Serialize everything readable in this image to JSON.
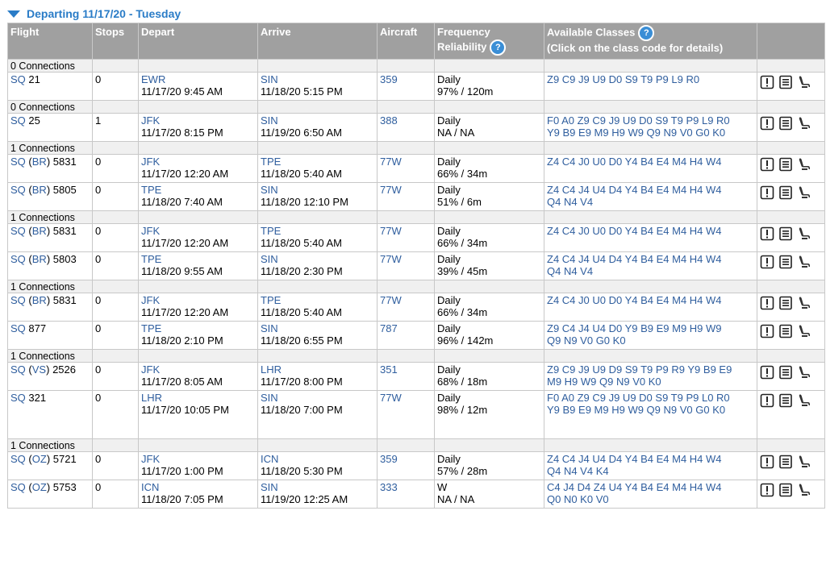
{
  "title": "Departing 11/17/20 - Tuesday",
  "headers": {
    "flight": "Flight",
    "stops": "Stops",
    "depart": "Depart",
    "arrive": "Arrive",
    "aircraft": "Aircraft",
    "frequency": "Frequency",
    "reliability": "Reliability",
    "classes": "Available Classes",
    "classes_note": "(Click on the class code for details)"
  },
  "groups": [
    {
      "label": "0 Connections",
      "flights": [
        {
          "airline": "SQ",
          "partner": "",
          "number": "21",
          "stops": "0",
          "depart_code": "EWR",
          "depart_time": "11/17/20 9:45 AM",
          "arrive_code": "SIN",
          "arrive_time": "11/18/20 5:15 PM",
          "aircraft": "359",
          "frequency": "Daily",
          "reliability": "97% / 120m",
          "classes": [
            "Z9 C9 J9 U9 D0 S9 T9 P9 L9 R0"
          ]
        }
      ]
    },
    {
      "label": "0 Connections",
      "flights": [
        {
          "airline": "SQ",
          "partner": "",
          "number": "25",
          "stops": "1",
          "depart_code": "JFK",
          "depart_time": "11/17/20 8:15 PM",
          "arrive_code": "SIN",
          "arrive_time": "11/19/20 6:50 AM",
          "aircraft": "388",
          "frequency": "Daily",
          "reliability": "NA / NA",
          "classes": [
            "F0 A0 Z9 C9 J9 U9 D0 S9 T9 P9 L9 R0",
            "Y9 B9 E9 M9 H9 W9 Q9 N9 V0 G0 K0"
          ]
        }
      ]
    },
    {
      "label": "1 Connections",
      "flights": [
        {
          "airline": "SQ",
          "partner": "BR",
          "number": "5831",
          "stops": "0",
          "depart_code": "JFK",
          "depart_time": "11/17/20 12:20 AM",
          "arrive_code": "TPE",
          "arrive_time": "11/18/20 5:40 AM",
          "aircraft": "77W",
          "frequency": "Daily",
          "reliability": "66% / 34m",
          "classes": [
            "Z4 C4 J0 U0 D0 Y4 B4 E4 M4 H4 W4"
          ]
        },
        {
          "airline": "SQ",
          "partner": "BR",
          "number": "5805",
          "stops": "0",
          "depart_code": "TPE",
          "depart_time": "11/18/20 7:40 AM",
          "arrive_code": "SIN",
          "arrive_time": "11/18/20 12:10 PM",
          "aircraft": "77W",
          "frequency": "Daily",
          "reliability": "51% / 6m",
          "classes": [
            "Z4 C4 J4 U4 D4 Y4 B4 E4 M4 H4 W4",
            "Q4 N4 V4"
          ]
        }
      ]
    },
    {
      "label": "1 Connections",
      "flights": [
        {
          "airline": "SQ",
          "partner": "BR",
          "number": "5831",
          "stops": "0",
          "depart_code": "JFK",
          "depart_time": "11/17/20 12:20 AM",
          "arrive_code": "TPE",
          "arrive_time": "11/18/20 5:40 AM",
          "aircraft": "77W",
          "frequency": "Daily",
          "reliability": "66% / 34m",
          "classes": [
            "Z4 C4 J0 U0 D0 Y4 B4 E4 M4 H4 W4"
          ]
        },
        {
          "airline": "SQ",
          "partner": "BR",
          "number": "5803",
          "stops": "0",
          "depart_code": "TPE",
          "depart_time": "11/18/20 9:55 AM",
          "arrive_code": "SIN",
          "arrive_time": "11/18/20 2:30 PM",
          "aircraft": "77W",
          "frequency": "Daily",
          "reliability": "39% / 45m",
          "classes": [
            "Z4 C4 J4 U4 D4 Y4 B4 E4 M4 H4 W4",
            "Q4 N4 V4"
          ]
        }
      ]
    },
    {
      "label": "1 Connections",
      "flights": [
        {
          "airline": "SQ",
          "partner": "BR",
          "number": "5831",
          "stops": "0",
          "depart_code": "JFK",
          "depart_time": "11/17/20 12:20 AM",
          "arrive_code": "TPE",
          "arrive_time": "11/18/20 5:40 AM",
          "aircraft": "77W",
          "frequency": "Daily",
          "reliability": "66% / 34m",
          "classes": [
            "Z4 C4 J0 U0 D0 Y4 B4 E4 M4 H4 W4"
          ]
        },
        {
          "airline": "SQ",
          "partner": "",
          "number": "877",
          "stops": "0",
          "depart_code": "TPE",
          "depart_time": "11/18/20 2:10 PM",
          "arrive_code": "SIN",
          "arrive_time": "11/18/20 6:55 PM",
          "aircraft": "787",
          "frequency": "Daily",
          "reliability": "96% / 142m",
          "classes": [
            "Z9 C4 J4 U4 D0 Y9 B9 E9 M9 H9 W9",
            "Q9 N9 V0 G0 K0"
          ]
        }
      ]
    },
    {
      "label": "1 Connections",
      "flights": [
        {
          "airline": "SQ",
          "partner": "VS",
          "number": "2526",
          "stops": "0",
          "depart_code": "JFK",
          "depart_time": "11/17/20 8:05 AM",
          "arrive_code": "LHR",
          "arrive_time": "11/17/20 8:00 PM",
          "aircraft": "351",
          "frequency": "Daily",
          "reliability": "68% / 18m",
          "classes": [
            "Z9 C9 J9 U9 D9 S9 T9 P9 R9 Y9 B9 E9",
            "M9 H9 W9 Q9 N9 V0 K0"
          ]
        },
        {
          "airline": "SQ",
          "partner": "",
          "number": "321",
          "stops": "0",
          "depart_code": "LHR",
          "depart_time": "11/17/20 10:05 PM",
          "arrive_code": "SIN",
          "arrive_time": "11/18/20 7:00 PM",
          "aircraft": "77W",
          "frequency": "Daily",
          "reliability": "98% / 12m",
          "classes": [
            "F0 A0 Z9 C9 J9 U9 D0 S9 T9 P9 L0 R0",
            "Y9 B9 E9 M9 H9 W9 Q9 N9 V0 G0 K0"
          ],
          "tall": true
        }
      ]
    },
    {
      "label": "1 Connections",
      "flights": [
        {
          "airline": "SQ",
          "partner": "OZ",
          "number": "5721",
          "stops": "0",
          "depart_code": "JFK",
          "depart_time": "11/17/20 1:00 PM",
          "arrive_code": "ICN",
          "arrive_time": "11/18/20 5:30 PM",
          "aircraft": "359",
          "frequency": "Daily",
          "reliability": "57% / 28m",
          "classes": [
            "Z4 C4 J4 U4 D4 Y4 B4 E4 M4 H4 W4",
            "Q4 N4 V4 K4"
          ]
        },
        {
          "airline": "SQ",
          "partner": "OZ",
          "number": "5753",
          "stops": "0",
          "depart_code": "ICN",
          "depart_time": "11/18/20 7:05 PM",
          "arrive_code": "SIN",
          "arrive_time": "11/19/20 12:25 AM",
          "aircraft": "333",
          "frequency": "W",
          "reliability": "NA / NA",
          "classes": [
            "C4 J4 D4 Z4 U4 Y4 B4 E4 M4 H4 W4",
            "Q0 N0 K0 V0"
          ]
        }
      ]
    }
  ],
  "icons": [
    "alert-icon",
    "details-icon",
    "seat-icon"
  ],
  "colors": {
    "header_bg": "#a0a0a0",
    "link": "#2f5e9e",
    "title": "#2a7cc7",
    "help": "#3a8ed6",
    "connection_bg": "#f0f0f0"
  }
}
